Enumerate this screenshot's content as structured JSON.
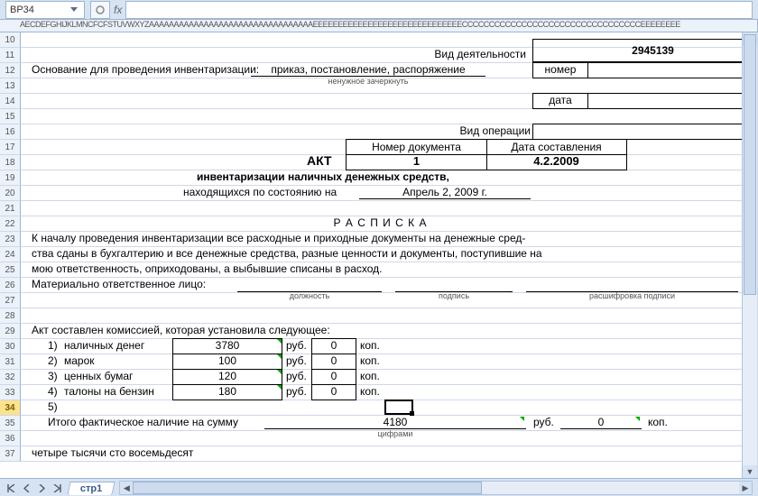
{
  "namebox": "BP34",
  "col_header": "AECDEFGHIJKLMNCFCFSTUVWXYZAAAAAAAAAAAAAAAAAAAAAAAAAAAAAAAAAEEEEEEEEEEEEEEEEEЕEEEEEEEEEEEECCCCCCCCCCCCCCCCCCCCCCCCCCCCCCCCCEEEEEEEE",
  "rows": [
    10,
    11,
    12,
    13,
    14,
    15,
    16,
    17,
    18,
    19,
    20,
    21,
    22,
    23,
    24,
    25,
    26,
    27,
    28,
    29,
    30,
    31,
    32,
    33,
    34,
    35,
    36,
    37
  ],
  "top": {
    "activity_label": "Вид деятельности",
    "activity_value": "2945139",
    "basis_label": "Основание для проведения инвентаризации:",
    "basis_value": "приказ,  постановление,  распоряжение",
    "basis_note": "ненужное зачеркнуть",
    "number_label": "номер",
    "date_label": "дата",
    "optype_label": "Вид операции"
  },
  "docbox": {
    "num_label": "Номер документа",
    "date_label": "Дата составления",
    "act": "АКТ",
    "num_value": "1",
    "date_value": "4.2.2009"
  },
  "title1": "инвентаризации наличных денежных средств,",
  "title2": "находящихся по состоянию на",
  "asof": "Апрель 2, 2009 г.",
  "receipt": "Р А С П И С К А",
  "para": [
    "К  началу  проведения  инвентаризации  все  расходные  и  приходные  документы  на  денежные  сред-",
    "ства сданы  в бухгалтерию  и все  денежные  средства,  разные  ценности  и документы, поступившие на",
    "мою ответственность, оприходованы, а выбывшие списаны в расход."
  ],
  "resp": {
    "label": "Материально ответственное лицо:",
    "c1": "должность",
    "c2": "подпись",
    "c3": "расшифровка подписи"
  },
  "table": {
    "intro": "Акт составлен комиссией, которая установила следующее:",
    "items": [
      {
        "n": "1)",
        "name": "наличных денег",
        "rub": "3780",
        "kop": "0"
      },
      {
        "n": "2)",
        "name": "марок",
        "rub": "100",
        "kop": "0"
      },
      {
        "n": "3)",
        "name": "ценных бумаг",
        "rub": "120",
        "kop": "0"
      },
      {
        "n": "4)",
        "name": "талоны на бензин",
        "rub": "180",
        "kop": "0"
      }
    ],
    "n5": "5)",
    "rub_lbl": "руб.",
    "kop_lbl": "коп."
  },
  "total": {
    "label": "Итого фактическое наличие на сумму",
    "rub": "4180",
    "kop": "0",
    "note": "цифрами",
    "rub_lbl": "руб.",
    "kop_lbl": "коп.",
    "words": "четыре тысячи сто восемьдесят"
  },
  "sheet": "стр1"
}
